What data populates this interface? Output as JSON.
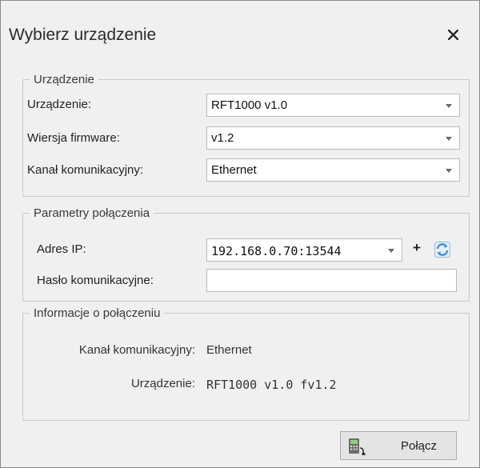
{
  "dialog": {
    "title": "Wybierz urządzenie",
    "close_label": "×"
  },
  "device_group": {
    "legend": "Urządzenie",
    "device_label": "Urządzenie:",
    "device_value": "RFT1000 v1.0",
    "firmware_label": "Wiersja firmware:",
    "firmware_value": "v1.2",
    "channel_label": "Kanał komunikacyjny:",
    "channel_value": "Ethernet"
  },
  "connection_group": {
    "legend": "Parametry połączenia",
    "ip_label": "Adres IP:",
    "ip_value": "192.168.0.70:13544",
    "add_label": "+",
    "password_label": "Hasło komunikacyjne:",
    "password_value": ""
  },
  "info_group": {
    "legend": "Informacje o połączeniu",
    "channel_label": "Kanał komunikacyjny:",
    "channel_value": "Ethernet",
    "device_label": "Urządzenie:",
    "device_value": "RFT1000 v1.0 fv1.2"
  },
  "footer": {
    "connect_label": "Połącz"
  },
  "icons": {
    "close": "close-icon",
    "dropdown": "chevron-down-icon",
    "add": "plus-icon",
    "refresh": "refresh-icon",
    "connect": "fiscal-printer-icon"
  },
  "colors": {
    "background": "#f0f0f0",
    "border": "#c8c8c8",
    "refresh_blue": "#3a8fd8"
  }
}
